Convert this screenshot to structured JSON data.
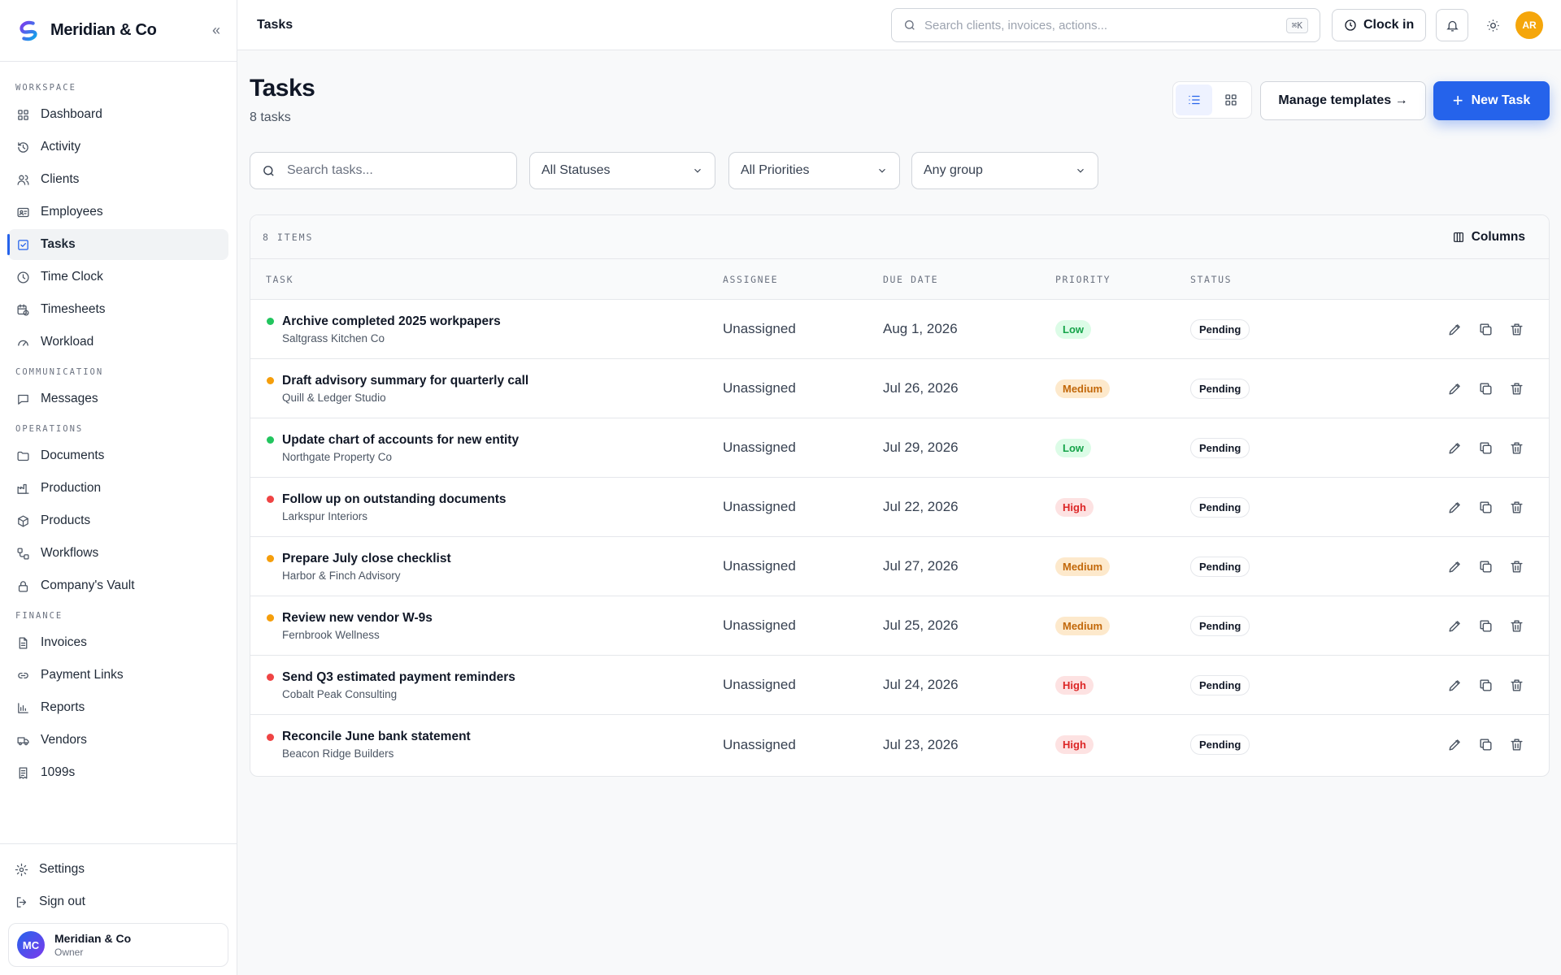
{
  "brand": {
    "name": "Meridian & Co"
  },
  "sidebar": {
    "sections": [
      {
        "label": "WORKSPACE",
        "items": [
          {
            "label": "Dashboard",
            "icon": "grid-icon"
          },
          {
            "label": "Activity",
            "icon": "history-icon"
          },
          {
            "label": "Clients",
            "icon": "users-icon"
          },
          {
            "label": "Employees",
            "icon": "id-card-icon"
          },
          {
            "label": "Tasks",
            "icon": "checkbox-icon",
            "active": true
          },
          {
            "label": "Time Clock",
            "icon": "clock-icon"
          },
          {
            "label": "Timesheets",
            "icon": "calendar-clock-icon"
          },
          {
            "label": "Workload",
            "icon": "gauge-icon"
          }
        ]
      },
      {
        "label": "COMMUNICATION",
        "items": [
          {
            "label": "Messages",
            "icon": "message-icon"
          }
        ]
      },
      {
        "label": "OPERATIONS",
        "items": [
          {
            "label": "Documents",
            "icon": "folder-icon"
          },
          {
            "label": "Production",
            "icon": "factory-icon"
          },
          {
            "label": "Products",
            "icon": "package-icon"
          },
          {
            "label": "Workflows",
            "icon": "workflow-icon"
          },
          {
            "label": "Company's Vault",
            "icon": "lock-icon"
          }
        ]
      },
      {
        "label": "FINANCE",
        "items": [
          {
            "label": "Invoices",
            "icon": "file-text-icon"
          },
          {
            "label": "Payment Links",
            "icon": "link-icon"
          },
          {
            "label": "Reports",
            "icon": "bar-chart-icon"
          },
          {
            "label": "Vendors",
            "icon": "truck-icon"
          },
          {
            "label": "1099s",
            "icon": "receipt-icon"
          }
        ]
      }
    ],
    "bottom": [
      {
        "label": "Settings",
        "icon": "gear-icon"
      },
      {
        "label": "Sign out",
        "icon": "sign-out-icon"
      }
    ],
    "user": {
      "initials": "MC",
      "name": "Meridian & Co",
      "role": "Owner"
    }
  },
  "topbar": {
    "title": "Tasks",
    "search_placeholder": "Search clients, invoices, actions...",
    "search_shortcut": "⌘K",
    "clock_in_label": "Clock in",
    "avatar_initials": "AR"
  },
  "page": {
    "title": "Tasks",
    "subtitle": "8 tasks",
    "manage_templates_label": "Manage templates →",
    "new_task_label": "New Task",
    "task_search_placeholder": "Search tasks...",
    "filters": {
      "status": "All Statuses",
      "priority": "All Priorities",
      "group": "Any group"
    }
  },
  "table": {
    "items_count": "8 ITEMS",
    "columns_label": "Columns",
    "headers": {
      "task": "TASK",
      "assignee": "ASSIGNEE",
      "due": "DUE DATE",
      "priority": "PRIORITY",
      "status": "STATUS"
    },
    "rows": [
      {
        "title": "Archive completed 2025 workpapers",
        "client": "Saltgrass Kitchen Co",
        "assignee": "Unassigned",
        "due": "Aug 1, 2026",
        "priority": "Low",
        "status": "Pending",
        "dot_color": "#22c55e"
      },
      {
        "title": "Draft advisory summary for quarterly call",
        "client": "Quill & Ledger Studio",
        "assignee": "Unassigned",
        "due": "Jul 26, 2026",
        "priority": "Medium",
        "status": "Pending",
        "dot_color": "#f59e0b"
      },
      {
        "title": "Update chart of accounts for new entity",
        "client": "Northgate Property Co",
        "assignee": "Unassigned",
        "due": "Jul 29, 2026",
        "priority": "Low",
        "status": "Pending",
        "dot_color": "#22c55e"
      },
      {
        "title": "Follow up on outstanding documents",
        "client": "Larkspur Interiors",
        "assignee": "Unassigned",
        "due": "Jul 22, 2026",
        "priority": "High",
        "status": "Pending",
        "dot_color": "#ef4444"
      },
      {
        "title": "Prepare July close checklist",
        "client": "Harbor & Finch Advisory",
        "assignee": "Unassigned",
        "due": "Jul 27, 2026",
        "priority": "Medium",
        "status": "Pending",
        "dot_color": "#f59e0b"
      },
      {
        "title": "Review new vendor W-9s",
        "client": "Fernbrook Wellness",
        "assignee": "Unassigned",
        "due": "Jul 25, 2026",
        "priority": "Medium",
        "status": "Pending",
        "dot_color": "#f59e0b"
      },
      {
        "title": "Send Q3 estimated payment reminders",
        "client": "Cobalt Peak Consulting",
        "assignee": "Unassigned",
        "due": "Jul 24, 2026",
        "priority": "High",
        "status": "Pending",
        "dot_color": "#ef4444"
      },
      {
        "title": "Reconcile June bank statement",
        "client": "Beacon Ridge Builders",
        "assignee": "Unassigned",
        "due": "Jul 23, 2026",
        "priority": "High",
        "status": "Pending",
        "dot_color": "#ef4444"
      }
    ]
  },
  "colors": {
    "accent": "#2563eb"
  }
}
